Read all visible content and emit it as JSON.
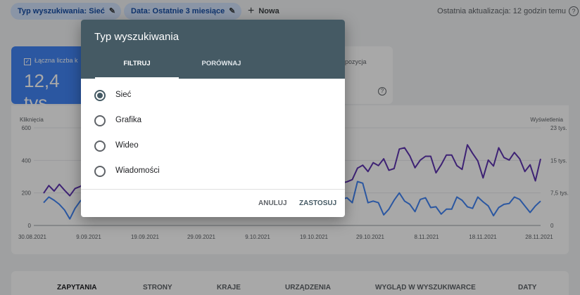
{
  "toolbar": {
    "filter_chip_search_type": "Typ wyszukiwania: Sieć",
    "filter_chip_date": "Data: Ostatnie 3 miesiące",
    "new_label": "Nowa",
    "last_update": "Ostatnia aktualizacja: 12 godzin temu",
    "help_glyph": "?"
  },
  "metrics": {
    "clicks_label": "Łączna liczba k",
    "clicks_value": "12,4 tys.",
    "position_label": "pozycja",
    "help_glyph": "?"
  },
  "chart_data": {
    "type": "line",
    "left_axis_title": "Kliknięcia",
    "right_axis_title": "Wyświetlenia",
    "left_ticks": [
      "600",
      "400",
      "200",
      "0"
    ],
    "right_ticks": [
      "23 tys.",
      "15 tys.",
      "7,5 tys.",
      "0"
    ],
    "left_ylim": [
      0,
      600
    ],
    "right_ylim": [
      0,
      23000
    ],
    "x_tick_labels": [
      "30.08.2021",
      "9.09.2021",
      "19.09.2021",
      "29.09.2021",
      "9.10.2021",
      "19.10.2021",
      "29.10.2021",
      "8.11.2021",
      "18.11.2021",
      "28.11.2021"
    ],
    "grid": true,
    "series": [
      {
        "name": "Kliknięcia",
        "axis": "left",
        "color": "#4285f4",
        "values": [
          140,
          175,
          155,
          130,
          95,
          40,
          105,
          150,
          175,
          180,
          160,
          170,
          150,
          130,
          145,
          160,
          150,
          140,
          120,
          130,
          150,
          170,
          160,
          140,
          130,
          150,
          160,
          150,
          140,
          130,
          150,
          180,
          170,
          150,
          140,
          160,
          170,
          150,
          130,
          140,
          170,
          160,
          150,
          130,
          140,
          150,
          160,
          140,
          120,
          150,
          140,
          170,
          180,
          165,
          140,
          150,
          130,
          160,
          170,
          140,
          270,
          260,
          140,
          150,
          140,
          65,
          100,
          155,
          200,
          150,
          130,
          85,
          160,
          170,
          110,
          115,
          70,
          100,
          100,
          175,
          155,
          115,
          105,
          175,
          145,
          120,
          60,
          110,
          130,
          135,
          175,
          160,
          120,
          80,
          120,
          150
        ]
      },
      {
        "name": "Wyświetlenia",
        "axis": "right",
        "color": "#5e35b1",
        "values": [
          7600,
          9400,
          8100,
          9700,
          8300,
          7000,
          8700,
          9200,
          10100,
          10500,
          9900,
          10300,
          9800,
          9500,
          10000,
          10600,
          10200,
          9900,
          9600,
          10100,
          10700,
          10400,
          9800,
          9500,
          10000,
          10800,
          10500,
          9900,
          9700,
          10300,
          11000,
          10600,
          10100,
          9800,
          10400,
          10900,
          10500,
          10000,
          9600,
          10200,
          11200,
          10800,
          10300,
          9900,
          10500,
          11000,
          10600,
          10100,
          9700,
          10300,
          11100,
          10700,
          10200,
          9800,
          10400,
          10900,
          10500,
          10000,
          10300,
          10800,
          13500,
          14200,
          12700,
          14800,
          14100,
          15700,
          13000,
          13400,
          18000,
          18300,
          16400,
          13600,
          15400,
          16300,
          16300,
          12400,
          14300,
          16600,
          16600,
          14100,
          13200,
          19000,
          17000,
          15200,
          11200,
          15400,
          14000,
          18300,
          16000,
          15400,
          17200,
          15700,
          12700,
          14300,
          10500,
          15700
        ]
      }
    ]
  },
  "bottom_tabs": [
    "ZAPYTANIA",
    "STRONY",
    "KRAJE",
    "URZĄDZENIA",
    "WYGLĄD W WYSZUKIWARCE",
    "DATY"
  ],
  "dialog": {
    "title": "Typ wyszukiwania",
    "tabs": [
      "FILTRUJ",
      "PORÓWNAJ"
    ],
    "options": [
      "Sieć",
      "Grafika",
      "Wideo",
      "Wiadomości"
    ],
    "selected_option": "Sieć",
    "cancel_label": "ANULUJ",
    "apply_label": "ZASTOSUJ"
  }
}
